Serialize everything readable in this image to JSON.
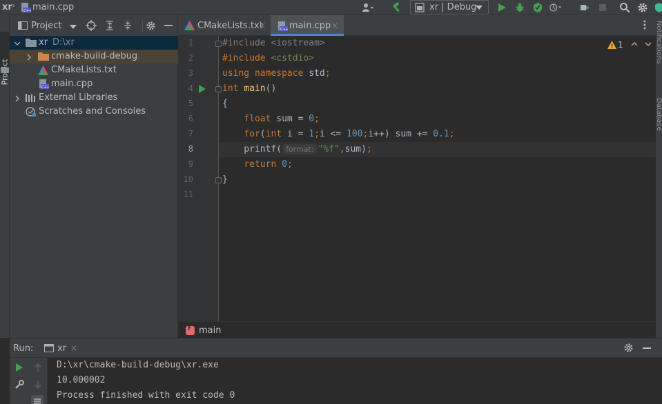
{
  "nav": {
    "root": "xr",
    "separator": "›",
    "file": "main.cpp"
  },
  "toolbar": {
    "run_config": "xr | Debug"
  },
  "left_stripe": {
    "project_label": "Project"
  },
  "project_panel": {
    "title": "Project",
    "tree": [
      {
        "label": "xr",
        "path": "D:\\xr"
      },
      {
        "label": "cmake-build-debug"
      },
      {
        "label": "CMakeLists.txt"
      },
      {
        "label": "main.cpp"
      },
      {
        "label": "External Libraries"
      },
      {
        "label": "Scratches and Consoles"
      }
    ]
  },
  "tabs": [
    {
      "label": "CMakeLists.txt",
      "close": "×"
    },
    {
      "label": "main.cpp",
      "close": "×"
    }
  ],
  "editor": {
    "line_numbers": [
      "1",
      "2",
      "3",
      "4",
      "5",
      "6",
      "7",
      "8",
      "9",
      "10",
      "11"
    ],
    "current_line": "8",
    "warnings": {
      "count": "1"
    },
    "parameter_hint": "format:",
    "lines": [
      [
        {
          "t": "pp",
          "v": "#include "
        },
        {
          "t": "pp",
          "v": "<iostream>"
        }
      ],
      [
        {
          "t": "kw",
          "v": "#include "
        },
        {
          "t": "inc",
          "v": "<cstdio>"
        }
      ],
      [
        {
          "t": "kw",
          "v": "using namespace "
        },
        {
          "t": "id",
          "v": "std"
        },
        {
          "t": "kw",
          "v": ";"
        }
      ],
      [
        {
          "t": "ty",
          "v": "int "
        },
        {
          "t": "fn",
          "v": "main"
        },
        {
          "t": "id",
          "v": "()"
        }
      ],
      [
        {
          "t": "id",
          "v": "{"
        }
      ],
      [
        {
          "t": "id",
          "v": "    "
        },
        {
          "t": "ty",
          "v": "float "
        },
        {
          "t": "id",
          "v": "sum = "
        },
        {
          "t": "num",
          "v": "0"
        },
        {
          "t": "kw",
          "v": ";"
        }
      ],
      [
        {
          "t": "id",
          "v": "    "
        },
        {
          "t": "kw",
          "v": "for"
        },
        {
          "t": "id",
          "v": "("
        },
        {
          "t": "ty",
          "v": "int "
        },
        {
          "t": "id",
          "v": "i = "
        },
        {
          "t": "num",
          "v": "1"
        },
        {
          "t": "kw",
          "v": ";"
        },
        {
          "t": "id",
          "v": "i <= "
        },
        {
          "t": "num",
          "v": "100"
        },
        {
          "t": "kw",
          "v": ";"
        },
        {
          "t": "id",
          "v": "i++) sum += "
        },
        {
          "t": "num",
          "v": "0.1"
        },
        {
          "t": "kw",
          "v": ";"
        }
      ],
      [
        {
          "t": "id",
          "v": "    printf("
        },
        {
          "t": "hint",
          "v": "format:"
        },
        {
          "t": "str",
          "v": "\"%f\""
        },
        {
          "t": "kw",
          "v": ","
        },
        {
          "t": "id",
          "v": "sum)"
        },
        {
          "t": "kw",
          "v": ";"
        }
      ],
      [
        {
          "t": "id",
          "v": "    "
        },
        {
          "t": "kw",
          "v": "return "
        },
        {
          "t": "num",
          "v": "0"
        },
        {
          "t": "kw",
          "v": ";"
        }
      ],
      [
        {
          "t": "id",
          "v": "}"
        }
      ],
      []
    ]
  },
  "breadcrumb": {
    "icon_letter": "f",
    "label": "main"
  },
  "right_stripe": {
    "notifications": "Notifications",
    "database": "Database"
  },
  "run_window": {
    "title": "Run:",
    "tab_label": "xr",
    "tab_close": "×",
    "console": [
      "D:\\xr\\cmake-build-debug\\xr.exe",
      "10.000002",
      "Process finished with exit code 0"
    ]
  },
  "colors": {
    "background": "#2b2b2b",
    "panel": "#3c3f41",
    "selection": "#0d293e",
    "keyword": "#cc7832",
    "string": "#6a8759",
    "number": "#6897bb",
    "function": "#ffc66d",
    "run_green": "#499c54",
    "tab_underline": "#4a88c7"
  },
  "icons": {
    "build": "hammer-icon",
    "run": "run-icon",
    "debug": "bug-icon",
    "search": "search-icon",
    "settings": "gear-icon"
  }
}
